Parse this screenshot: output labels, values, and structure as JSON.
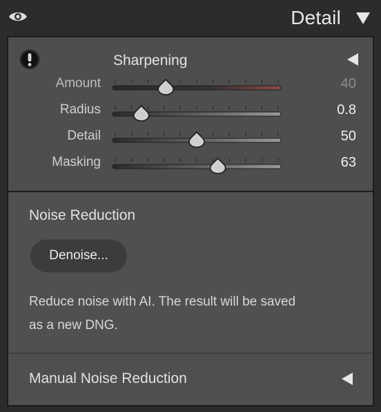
{
  "header": {
    "title": "Detail",
    "visibility_icon": "eye-icon",
    "toggle_icon": "triangle-down-icon"
  },
  "sharpening": {
    "title": "Sharpening",
    "warning_icon": "exclamation-icon",
    "toggle_icon": "triangle-left-icon",
    "sliders": [
      {
        "label": "Amount",
        "value": "40",
        "fraction": 0.31,
        "dimmed": true,
        "highlight": "red"
      },
      {
        "label": "Radius",
        "value": "0.8",
        "fraction": 0.16,
        "dimmed": false,
        "highlight": null
      },
      {
        "label": "Detail",
        "value": "50",
        "fraction": 0.5,
        "dimmed": false,
        "highlight": null
      },
      {
        "label": "Masking",
        "value": "63",
        "fraction": 0.63,
        "dimmed": false,
        "highlight": null
      }
    ]
  },
  "noise_reduction": {
    "title": "Noise Reduction",
    "button_label": "Denoise...",
    "description_line1": "Reduce noise with AI. The result will be saved",
    "description_line2": "as a new DNG."
  },
  "manual_noise_reduction": {
    "title": "Manual Noise Reduction",
    "toggle_icon": "triangle-left-icon"
  },
  "colors": {
    "panel_bg": "#505050",
    "header_bg": "#2c2c2c",
    "amount_track_highlight": "#8a4a4a"
  }
}
